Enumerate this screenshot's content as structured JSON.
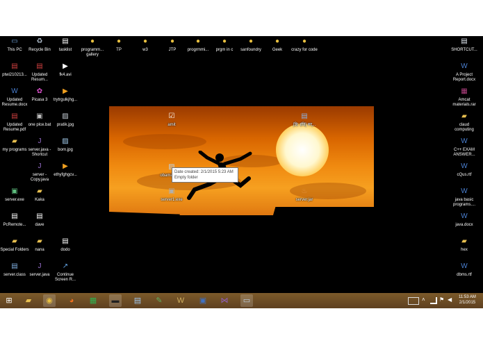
{
  "desktop_icons": [
    {
      "id": "this-pc",
      "label": "This PC",
      "icon": "computer-icon",
      "color": "#6fa3d8"
    },
    {
      "id": "recycle-bin",
      "label": "Recycle Bin",
      "icon": "recycle-bin-icon",
      "color": "#b9c7d6"
    },
    {
      "id": "tasklist",
      "label": "tasklist",
      "icon": "document-icon",
      "color": "#ffffff"
    },
    {
      "id": "programming-gallery",
      "label": "programm... gallery",
      "icon": "chrome-shortcut-icon",
      "color": "#e8c040"
    },
    {
      "id": "tp",
      "label": "TP",
      "icon": "chrome-shortcut-icon",
      "color": "#e8c040"
    },
    {
      "id": "w3",
      "label": "w3",
      "icon": "chrome-shortcut-icon",
      "color": "#e8c040"
    },
    {
      "id": "jtp",
      "label": "JTP",
      "icon": "chrome-shortcut-icon",
      "color": "#e8c040"
    },
    {
      "id": "programming-2",
      "label": "progrmmi...",
      "icon": "chrome-shortcut-icon",
      "color": "#e8c040"
    },
    {
      "id": "prgm-in-c",
      "label": "prgm in c",
      "icon": "chrome-shortcut-icon",
      "color": "#e8c040"
    },
    {
      "id": "sanfoundry",
      "label": "sanfoundry",
      "icon": "chrome-shortcut-icon",
      "color": "#e8c040"
    },
    {
      "id": "geek",
      "label": "Geek",
      "icon": "chrome-shortcut-icon",
      "color": "#e8c040"
    },
    {
      "id": "crazy-for-code",
      "label": "crazy for code",
      "icon": "chrome-shortcut-icon",
      "color": "#e8c040"
    },
    {
      "id": "shortcut",
      "label": "SHORTCUT...",
      "icon": "document-icon",
      "color": "#dfe6ee"
    },
    {
      "id": "ptwi",
      "label": "ptwi210213...",
      "icon": "pdf-icon",
      "color": "#d04040"
    },
    {
      "id": "updated-resume-1",
      "label": "Updated Resum...",
      "icon": "pdf-icon",
      "color": "#d04040"
    },
    {
      "id": "fk4-avi",
      "label": "fk4.avi",
      "icon": "video-icon",
      "color": "#ffffff"
    },
    {
      "id": "a-project-report",
      "label": "A Project Report.docx",
      "icon": "word-doc-icon",
      "color": "#4a7fd0"
    },
    {
      "id": "updated-resume-docx",
      "label": "Updated Resume.docx",
      "icon": "word-doc-icon",
      "color": "#4a7fd0"
    },
    {
      "id": "picasa-3",
      "label": "Picasa 3",
      "icon": "picasa-icon",
      "color": "#d84fc8"
    },
    {
      "id": "trytrgulkjhg",
      "label": "trytrgulkjhg...",
      "icon": "video-icon",
      "color": "#f0a020"
    },
    {
      "id": "amcat-rar",
      "label": "Amcat materials.rar",
      "icon": "archive-icon",
      "color": "#b04080"
    },
    {
      "id": "updated-resume-pdf",
      "label": "Updated Resume.pdf",
      "icon": "pdf-icon",
      "color": "#d04040"
    },
    {
      "id": "one-plce-bat",
      "label": "one plce.bat",
      "icon": "batch-file-icon",
      "color": "#c0c0c0"
    },
    {
      "id": "pratik-jpg",
      "label": "pratik.jpg",
      "icon": "image-icon",
      "color": "#c0c8d0"
    },
    {
      "id": "cloud-computing",
      "label": "claud computing",
      "icon": "folder-icon",
      "color": "#e8c050"
    },
    {
      "id": "amit-folder",
      "label": "amit",
      "icon": "folder-checkbox-icon",
      "color": "#ffffff"
    },
    {
      "id": "hindi-file",
      "label": "[हि: इंडि] सर्...",
      "icon": "document-icon",
      "color": "#8ab0e0"
    },
    {
      "id": "my-programs",
      "label": "my programs",
      "icon": "folder-icon",
      "color": "#e8c050"
    },
    {
      "id": "server-java-shortcut",
      "label": "server.java - Shortcut",
      "icon": "java-file-icon",
      "color": "#9a70d0"
    },
    {
      "id": "born-jpg",
      "label": "born.jpg",
      "icon": "image-icon",
      "color": "#a0c8e8"
    },
    {
      "id": "cpp-exam",
      "label": "C++ EXAM ANSWER...",
      "icon": "word-doc-icon",
      "color": "#4a7fd0"
    },
    {
      "id": "obama-do",
      "label": "obama_do...",
      "icon": "image-icon",
      "color": "#c0d0e0"
    },
    {
      "id": "server-copy-java",
      "label": "server - Copy.java",
      "icon": "java-file-icon",
      "color": "#9a70d0"
    },
    {
      "id": "ethyfghgcv",
      "label": "ethyfghgcv...",
      "icon": "video-icon",
      "color": "#f0a020"
    },
    {
      "id": "cqus-rtf",
      "label": "cQus.rtf",
      "icon": "word-doc-icon",
      "color": "#4a7fd0"
    },
    {
      "id": "server-exe",
      "label": "server.exe",
      "icon": "exe-icon",
      "color": "#60c080"
    },
    {
      "id": "kaka",
      "label": "Kaka",
      "icon": "folder-icon",
      "color": "#e8c050"
    },
    {
      "id": "server1-exe",
      "label": "server1.exe",
      "icon": "exe-icon",
      "color": "#b0b0b0"
    },
    {
      "id": "server-jar",
      "label": "server.jar",
      "icon": "jar-icon",
      "color": "#e09040"
    },
    {
      "id": "java-basic-programs",
      "label": "java basic programs....",
      "icon": "word-doc-icon",
      "color": "#4a7fd0"
    },
    {
      "id": "pcremote",
      "label": "PcRemote...",
      "icon": "document-icon",
      "color": "#ffffff"
    },
    {
      "id": "dave",
      "label": "dave",
      "icon": "document-icon",
      "color": "#ffffff"
    },
    {
      "id": "java-docx",
      "label": "java.docx",
      "icon": "word-doc-icon",
      "color": "#4a7fd0"
    },
    {
      "id": "special-folders",
      "label": "Special Folders",
      "icon": "folder-icon",
      "color": "#e8c050"
    },
    {
      "id": "nana",
      "label": "nana",
      "icon": "folder-icon",
      "color": "#e8c050"
    },
    {
      "id": "dodo",
      "label": "dodo",
      "icon": "document-icon",
      "color": "#ffffff"
    },
    {
      "id": "hex",
      "label": "hex",
      "icon": "folder-icon",
      "color": "#e8c050"
    },
    {
      "id": "server-class",
      "label": "server.class",
      "icon": "class-file-icon",
      "color": "#80b0e0"
    },
    {
      "id": "server-java",
      "label": "server.java",
      "icon": "java-file-icon",
      "color": "#9a70d0"
    },
    {
      "id": "continue-screen",
      "label": "Continue Screen R...",
      "icon": "shortcut-icon",
      "color": "#60a0e0"
    },
    {
      "id": "dbms-rtf",
      "label": "dbms.rtf",
      "icon": "word-doc-icon",
      "color": "#4a7fd0"
    }
  ],
  "tooltip": {
    "line1": "Date created: 2/1/2015 5:23 AM",
    "line2": "Empty folder"
  },
  "taskbar": {
    "pinned": [
      {
        "id": "start",
        "icon": "windows-start-icon",
        "color": "#ffffff",
        "active": false
      },
      {
        "id": "file-explorer",
        "icon": "folder-icon",
        "color": "#e8c050",
        "active": false
      },
      {
        "id": "chrome",
        "icon": "chrome-icon",
        "color": "#e8c040",
        "active": true
      },
      {
        "id": "firefox",
        "icon": "firefox-icon",
        "color": "#f07020",
        "active": false
      },
      {
        "id": "store",
        "icon": "store-icon",
        "color": "#30b050",
        "active": false
      },
      {
        "id": "cmd",
        "icon": "command-prompt-icon",
        "color": "#202020",
        "active": true
      },
      {
        "id": "notepad",
        "icon": "notepad-icon",
        "color": "#a0c8f0",
        "active": false
      },
      {
        "id": "paint",
        "icon": "paint-icon",
        "color": "#60b060",
        "active": false
      },
      {
        "id": "word",
        "icon": "word-icon",
        "color": "#d0b060",
        "active": false
      },
      {
        "id": "network-tool",
        "icon": "network-icon",
        "color": "#4070c0",
        "active": false
      },
      {
        "id": "visual-studio",
        "icon": "visual-studio-icon",
        "color": "#9060c0",
        "active": false
      },
      {
        "id": "remote",
        "icon": "remote-desktop-icon",
        "color": "#c0d0e0",
        "active": true
      }
    ],
    "clock_time": "11:53 AM",
    "clock_date": "2/1/2015"
  }
}
